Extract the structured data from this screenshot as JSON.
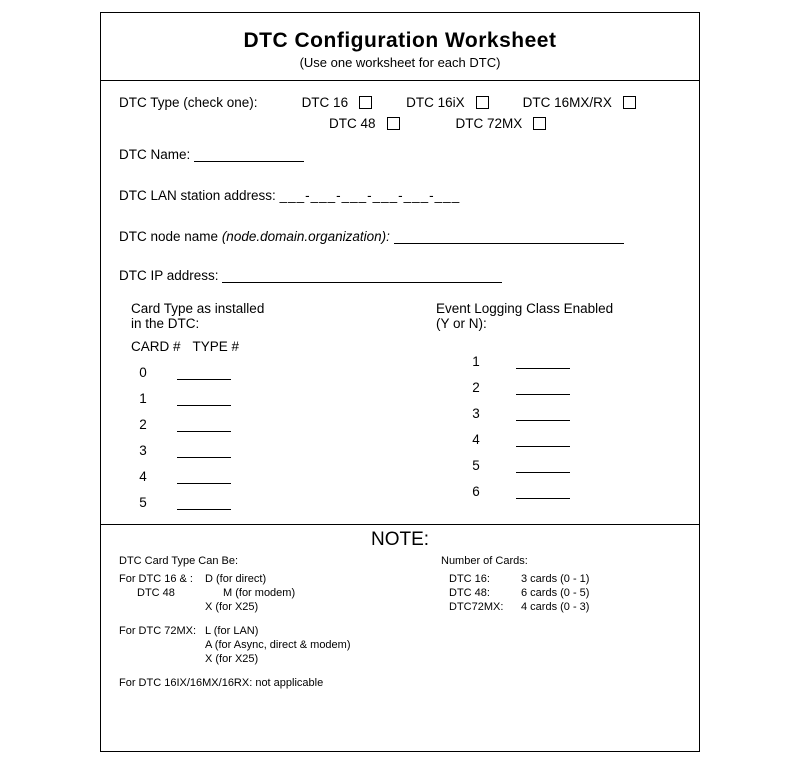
{
  "header": {
    "title": "DTC Configuration Worksheet",
    "subtitle": "(Use one worksheet for each DTC)"
  },
  "typeRow": {
    "label": "DTC Type (check one):",
    "opt1": "DTC 16",
    "opt2": "DTC 16iX",
    "opt3": "DTC 16MX/RX",
    "opt4": "DTC 48",
    "opt5": "DTC 72MX"
  },
  "fields": {
    "nameLabel": "DTC Name:",
    "lanLabel": "DTC LAN station address:",
    "macSep": "___-___-___-___-___-___",
    "nodeLabel": "DTC node name ",
    "nodeHint": "(node.domain.organization):",
    "ipLabel": "DTC IP address:"
  },
  "cards": {
    "heading1": "Card Type as installed",
    "heading2": "in the DTC:",
    "colCard": "CARD #",
    "colType": "TYPE #",
    "nums": [
      "0",
      "1",
      "2",
      "3",
      "4",
      "5"
    ]
  },
  "events": {
    "heading1": "Event Logging Class Enabled",
    "heading2": "(Y or N):",
    "nums": [
      "1",
      "2",
      "3",
      "4",
      "5",
      "6"
    ]
  },
  "note": {
    "title": "NOTE:",
    "cardTypeHead": "DTC Card Type Can Be:",
    "g1_label": "For DTC 16 & :",
    "g1_a": "D (for direct)",
    "g2_label": "DTC 48",
    "g2_a": "M (for modem)",
    "g2_b": "X (for X25)",
    "g3_label": "For DTC 72MX:",
    "g3_a": "L (for LAN)",
    "g3_b": "A (for Async, direct & modem)",
    "g3_c": "X (for X25)",
    "g4": "For DTC 16IX/16MX/16RX: not applicable",
    "numHead": "Number of Cards:",
    "n1k": "DTC 16:",
    "n1v": "3 cards (0 - 1)",
    "n2k": "DTC 48:",
    "n2v": "6 cards (0 - 5)",
    "n3k": "DTC72MX:",
    "n3v": "4 cards (0 - 3)"
  }
}
